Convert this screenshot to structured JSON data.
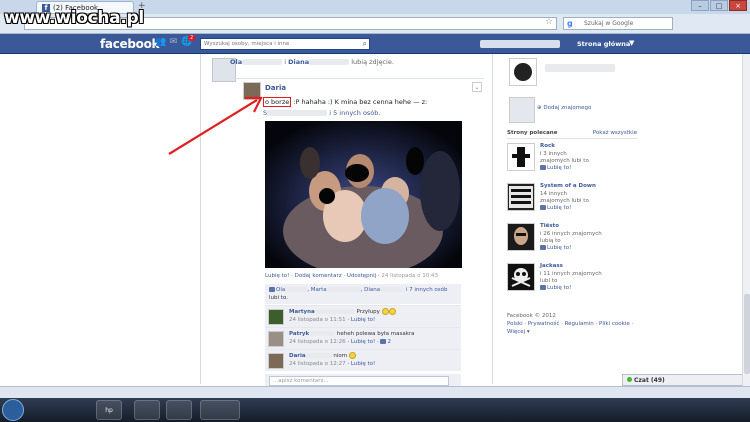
{
  "browser": {
    "tab_title": "(2) Facebook",
    "tab_favicon": "f",
    "new_tab": "+",
    "search_placeholder": "Szukaj w Google",
    "search_engine_icon": "g",
    "star_icon": "☆",
    "window_buttons": [
      "–",
      "□",
      "×"
    ]
  },
  "watermark": "www.wiocha.pl",
  "fb": {
    "logo": "facebook",
    "notification_count": "2",
    "search_placeholder": "Wyszukaj osoby, miejsca i inne",
    "home_label": "Strona główna",
    "account_arrow": "▼",
    "brand_color": "#3b5998"
  },
  "feed": {
    "shared_line": {
      "user1": "Ola",
      "user2": "Diana",
      "action": "lubią zdjęcie."
    },
    "post": {
      "author": "Daria",
      "text_boxed": "o borze",
      "text_rest": ":P hahaha :) K          mina bez cenna hehe",
      "text_tail": "— z:",
      "with_s": "S",
      "with_more": "i 5 innych osób.",
      "actions": {
        "like": "Lubię to!",
        "comment": "Dodaj komentarz",
        "share": "Udostępnij",
        "time": "24 listopada o 10:43"
      },
      "likes": {
        "u1": "Ola",
        "u2": "Marta",
        "u3": "Diana",
        "more": "i 7 innych osób",
        "suffix": "lubi to."
      },
      "comments": [
        {
          "name": "Martyna",
          "text": "Przyłupy",
          "time": "24 listopada o 11:51",
          "like": "Lubię to!",
          "count": ""
        },
        {
          "name": "Patryk",
          "text": "heheh polewa była masakra",
          "time": "24 listopada o 12:26",
          "like": "Lubię to!",
          "count": "2"
        },
        {
          "name": "Daria",
          "text": "niom",
          "time": "24 listopada o 12:27",
          "like": "Lubię to!",
          "count": ""
        }
      ],
      "write_placeholder": "...apisz komentarz..."
    }
  },
  "sidebar": {
    "add_friend": "Dodaj znajomego",
    "pages_header": "Strony polecane",
    "pages_see_all": "Pokaż wszystkie",
    "pages": [
      {
        "name": "Rock",
        "meta_a": "i 3 innych",
        "meta_b": "znajomych lubi to",
        "like": "Lubię to!"
      },
      {
        "name": "System of a Down",
        "meta_a": "14 innych",
        "meta_b": "znajomych lubi to",
        "like": "Lubię to!"
      },
      {
        "name": "Tiësto",
        "meta_a": "i 26 innych znajomych",
        "meta_b": "lubią to",
        "like": "Lubię to!"
      },
      {
        "name": "Jackass",
        "meta_a": "i 11 innych znajomych",
        "meta_b": "lubi to",
        "like": "Lubię to!"
      }
    ],
    "footer": {
      "copy": "Facebook © 2012",
      "links": "Polski · Prywatność · Regulamin · Pliki cookie ·",
      "more": "Więcej ▾"
    }
  },
  "chat": {
    "label": "Czat (49)"
  },
  "taskbar": {
    "hp_icon": "hp"
  }
}
